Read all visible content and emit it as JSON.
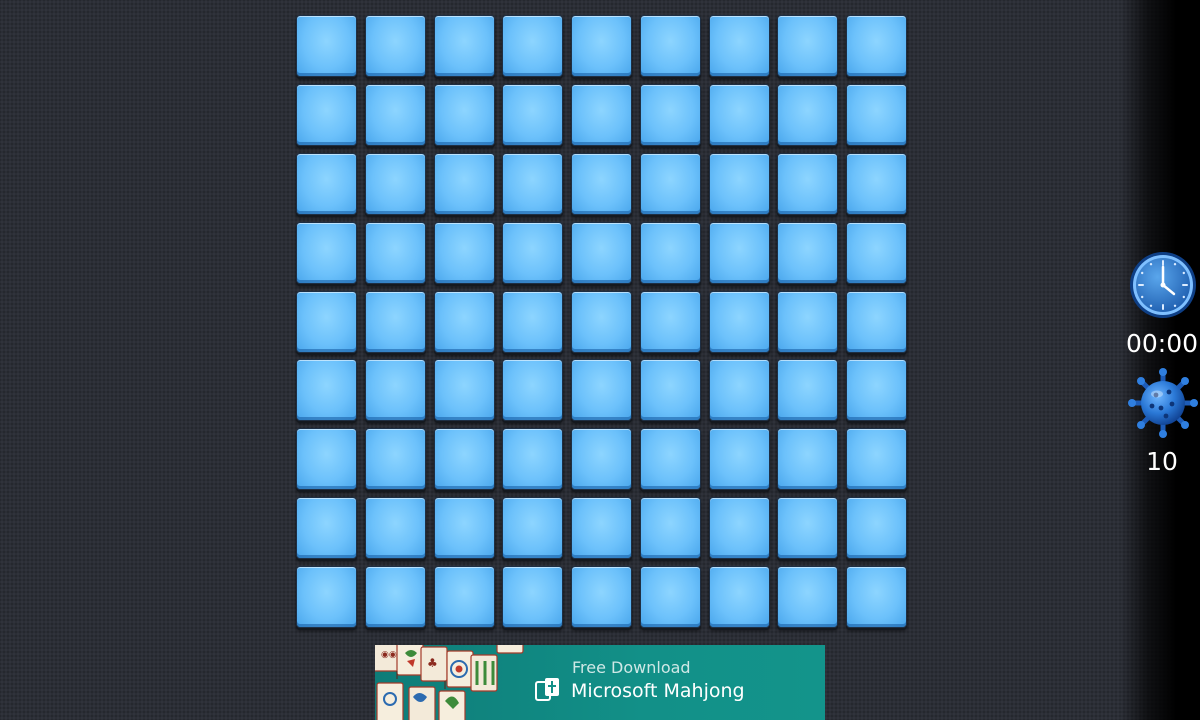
{
  "board": {
    "rows": 9,
    "cols": 9,
    "tile_state": "unrevealed"
  },
  "status": {
    "timer": "00:00",
    "mines_remaining": "10",
    "clock_icon": "clock-icon",
    "mine_icon": "mine-icon"
  },
  "ad": {
    "line1": "Free Download",
    "line2": "Microsoft Mahjong"
  },
  "colors": {
    "background": "#2b2e36",
    "tile": "#6cc1fb",
    "ad_background": "#129088",
    "text": "#ffffff"
  }
}
